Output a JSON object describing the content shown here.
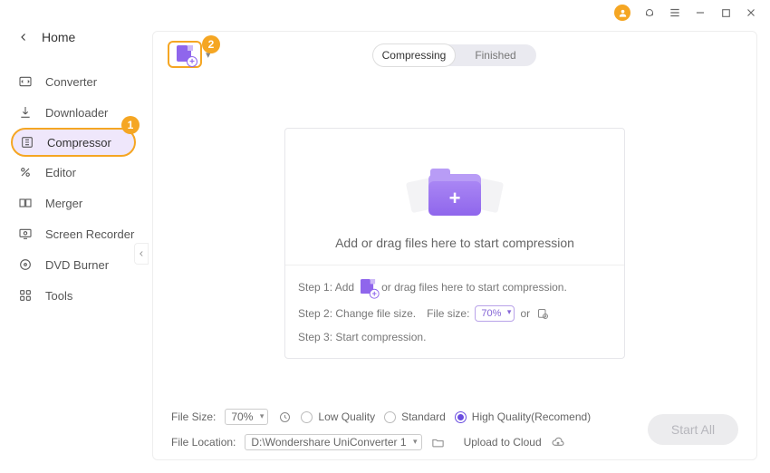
{
  "titlebar": {
    "avatar_initial": ""
  },
  "sidebar": {
    "home": "Home",
    "items": [
      {
        "label": "Converter"
      },
      {
        "label": "Downloader"
      },
      {
        "label": "Compressor"
      },
      {
        "label": "Editor"
      },
      {
        "label": "Merger"
      },
      {
        "label": "Screen Recorder"
      },
      {
        "label": "DVD Burner"
      },
      {
        "label": "Tools"
      }
    ]
  },
  "annotations": {
    "badge1": "1",
    "badge2": "2"
  },
  "tabs": {
    "compressing": "Compressing",
    "finished": "Finished"
  },
  "drop": {
    "title": "Add or drag files here to start compression",
    "step1_a": "Step 1: Add",
    "step1_b": "or drag files here to start compression.",
    "step2_a": "Step 2: Change file size.",
    "step2_label": "File size:",
    "step2_pct": "70%",
    "step2_or": "or",
    "step3": "Step 3: Start compression."
  },
  "bottom": {
    "filesize_label": "File Size:",
    "filesize_value": "70%",
    "quality_low": "Low Quality",
    "quality_standard": "Standard",
    "quality_high": "High Quality(Recomend)",
    "fileloc_label": "File Location:",
    "fileloc_value": "D:\\Wondershare UniConverter 1",
    "upload_label": "Upload to Cloud",
    "start_all": "Start All"
  }
}
